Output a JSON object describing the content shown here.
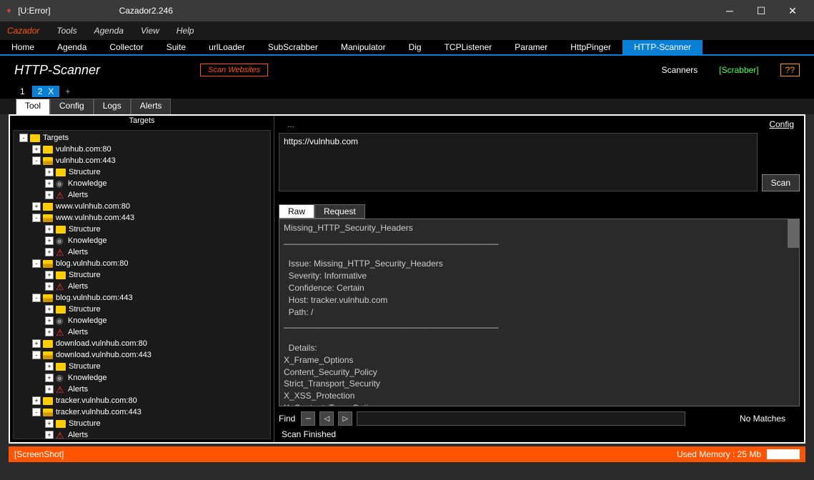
{
  "window": {
    "error": "[U:Error]",
    "title": "Cazador2.246"
  },
  "menu": [
    "Cazador",
    "Tools",
    "Agenda",
    "View",
    "Help"
  ],
  "tabs": [
    "Home",
    "Agenda",
    "Collector",
    "Suite",
    "urlLoader",
    "SubScrabber",
    "Manipulator",
    "Dig",
    "TCPListener",
    "Paramer",
    "HttpPinger",
    "HTTP-Scanner"
  ],
  "active_tab": "HTTP-Scanner",
  "tool": {
    "title": "HTTP-Scanner",
    "scan_btn": "Scan Websites",
    "scanners": "Scanners",
    "scrabber": "[Scrabber]",
    "q": "??"
  },
  "subtabs": {
    "items": [
      "1",
      "2"
    ],
    "active": "2",
    "close": "X",
    "plus": "+"
  },
  "cfgtabs": [
    "Tool",
    "Config",
    "Logs",
    "Alerts"
  ],
  "tree_title": "Targets",
  "tree": [
    {
      "d": 0,
      "e": "-",
      "i": "f",
      "t": "Targets"
    },
    {
      "d": 1,
      "e": "+",
      "i": "f",
      "t": "vulnhub.com:80"
    },
    {
      "d": 1,
      "e": "-",
      "i": "fo",
      "t": "vulnhub.com:443"
    },
    {
      "d": 2,
      "e": "+",
      "i": "f",
      "t": "Structure"
    },
    {
      "d": 2,
      "e": "+",
      "i": "k",
      "t": "Knowledge"
    },
    {
      "d": 2,
      "e": "+",
      "i": "a",
      "t": "Alerts"
    },
    {
      "d": 1,
      "e": "+",
      "i": "f",
      "t": "www.vulnhub.com:80"
    },
    {
      "d": 1,
      "e": "-",
      "i": "fo",
      "t": "www.vulnhub.com:443"
    },
    {
      "d": 2,
      "e": "+",
      "i": "f",
      "t": "Structure"
    },
    {
      "d": 2,
      "e": "+",
      "i": "k",
      "t": "Knowledge"
    },
    {
      "d": 2,
      "e": "+",
      "i": "a",
      "t": "Alerts"
    },
    {
      "d": 1,
      "e": "-",
      "i": "fo",
      "t": "blog.vulnhub.com:80"
    },
    {
      "d": 2,
      "e": "+",
      "i": "f",
      "t": "Structure"
    },
    {
      "d": 2,
      "e": "+",
      "i": "a",
      "t": "Alerts"
    },
    {
      "d": 1,
      "e": "-",
      "i": "fo",
      "t": "blog.vulnhub.com:443"
    },
    {
      "d": 2,
      "e": "+",
      "i": "f",
      "t": "Structure"
    },
    {
      "d": 2,
      "e": "+",
      "i": "k",
      "t": "Knowledge"
    },
    {
      "d": 2,
      "e": "+",
      "i": "a",
      "t": "Alerts"
    },
    {
      "d": 1,
      "e": "+",
      "i": "f",
      "t": "download.vulnhub.com:80"
    },
    {
      "d": 1,
      "e": "-",
      "i": "fo",
      "t": "download.vulnhub.com:443"
    },
    {
      "d": 2,
      "e": "+",
      "i": "f",
      "t": "Structure"
    },
    {
      "d": 2,
      "e": "+",
      "i": "k",
      "t": "Knowledge"
    },
    {
      "d": 2,
      "e": "+",
      "i": "a",
      "t": "Alerts"
    },
    {
      "d": 1,
      "e": "+",
      "i": "f",
      "t": "tracker.vulnhub.com:80"
    },
    {
      "d": 1,
      "e": "-",
      "i": "fo",
      "t": "tracker.vulnhub.com:443"
    },
    {
      "d": 2,
      "e": "+",
      "i": "f",
      "t": "Structure"
    },
    {
      "d": 2,
      "e": "+",
      "i": "a",
      "t": "Alerts"
    }
  ],
  "right": {
    "dots": "...",
    "config": "Config",
    "url": "https://vulnhub.com",
    "scan": "Scan"
  },
  "rawtabs": [
    "Raw",
    "Request"
  ],
  "raw_text": "Missing_HTTP_Security_Headers\n_____________________________________________\n\n  Issue: Missing_HTTP_Security_Headers\n  Severity: Informative\n  Confidence: Certain\n  Host: tracker.vulnhub.com\n  Path: /\n_____________________________________________\n\n  Details:\nX_Frame_Options\nContent_Security_Policy\nStrict_Transport_Security\nX_XSS_Protection\nX_Content_Type_Options\nReferrer_Policy\nFeature_Policy",
  "find": {
    "label": "Find",
    "nomatch": "No Matches"
  },
  "scan_status": "Scan Finished",
  "status": {
    "shot": "[ScreenShot]",
    "mem": "Used Memory : 25 Mb"
  }
}
